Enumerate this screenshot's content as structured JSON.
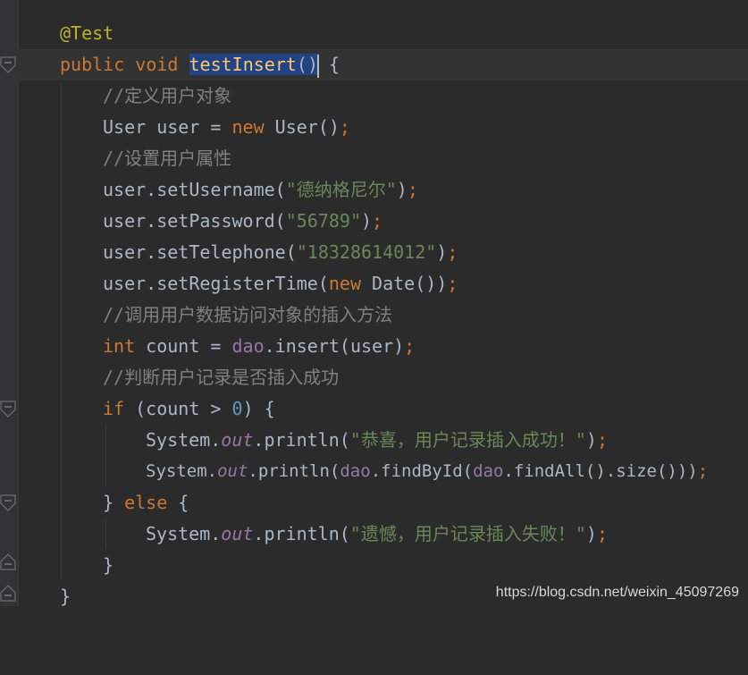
{
  "colors": {
    "background": "#2b2b2b",
    "gutter": "#313335",
    "current_line": "#323232",
    "selection": "#214283",
    "default_text": "#a9b7c6",
    "keyword": "#cc7832",
    "annotation": "#bbb529",
    "method_declaration": "#ffc66d",
    "comment": "#808080",
    "string": "#6a8759",
    "number": "#6897bb",
    "field": "#9876aa"
  },
  "code": {
    "l1": {
      "annotation": "@Test"
    },
    "l2": {
      "kw": "public void ",
      "method": "testInsert",
      "parens": "()",
      "brace": " {"
    },
    "l3": {
      "comment": "//定义用户对象"
    },
    "l4": {
      "type": "User user = ",
      "kw": "new",
      "call": " User()",
      "semi": ";"
    },
    "l5": {
      "comment": "//设置用户属性"
    },
    "l6": {
      "call": "user.setUsername(",
      "str": "\"德纳格尼尔\"",
      "close": ")",
      "semi": ";"
    },
    "l7": {
      "call": "user.setPassword(",
      "str": "\"56789\"",
      "close": ")",
      "semi": ";"
    },
    "l8": {
      "call": "user.setTelephone(",
      "str": "\"18328614012\"",
      "close": ")",
      "semi": ";"
    },
    "l9": {
      "call": "user.setRegisterTime(",
      "kw": "new",
      "call2": " Date())",
      "semi": ";"
    },
    "l10": {
      "comment": "//调用用户数据访问对象的插入方法"
    },
    "l11": {
      "kw": "int",
      "text": " count = ",
      "field": "dao",
      "call": ".insert(user)",
      "semi": ";"
    },
    "l12": {
      "comment": "//判断用户记录是否插入成功"
    },
    "l13": {
      "kw": "if",
      "text": " (count > ",
      "num": "0",
      "close": ") {"
    },
    "l14": {
      "text": "System.",
      "sfield": "out",
      "call": ".println(",
      "str": "\"恭喜，用户记录插入成功！\"",
      "close": ")",
      "semi": ";"
    },
    "l15": {
      "text": "System.",
      "sfield": "out",
      "call": ".println(",
      "field": "dao",
      "call2": ".findById(",
      "field2": "dao",
      "call3": ".findAll().size()))",
      "semi": ";"
    },
    "l16": {
      "open": "} ",
      "kw": "else",
      "close": " {"
    },
    "l17": {
      "text": "System.",
      "sfield": "out",
      "call": ".println(",
      "str": "\"遗憾，用户记录插入失败！\"",
      "close": ")",
      "semi": ";"
    },
    "l18": {
      "text": "}"
    },
    "l19": {
      "text": "}"
    }
  },
  "watermark": "https://blog.csdn.net/weixin_45097269"
}
